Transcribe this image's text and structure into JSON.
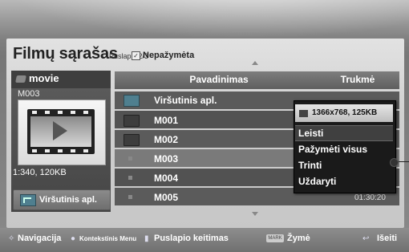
{
  "header": {
    "title": "Filmų sąrašas",
    "page_indicator": "Puslapis 2/3",
    "checkbox_symbol": "✓",
    "unselected_label": "Nepažymėta"
  },
  "left_panel": {
    "type_label": "movie",
    "selected_file": "M003",
    "file_info": "1:340, 120KB",
    "up_folder_button": "Viršutinis apl."
  },
  "list": {
    "columns": [
      "Pavadinimas",
      "Trukmė"
    ],
    "rows": [
      {
        "name": "Viršutinis apl.",
        "duration": "",
        "icon": "folder-up-icon"
      },
      {
        "name": "M001",
        "duration": "",
        "icon": "folder-icon"
      },
      {
        "name": "M002",
        "duration": "",
        "icon": "folder-icon"
      },
      {
        "name": "M003",
        "duration": "",
        "icon": "file-icon",
        "highlighted": true
      },
      {
        "name": "M004",
        "duration": "",
        "icon": "file-icon"
      },
      {
        "name": "M005",
        "duration": "01:30:20",
        "icon": "file-icon"
      }
    ]
  },
  "context_menu": {
    "info": "1366x768, 125KB",
    "items": [
      "Leisti",
      "Pažymėti visus",
      "Trinti",
      "Uždaryti"
    ],
    "selected_index": 0
  },
  "footer": {
    "navigation": "Navigacija",
    "context_menu": "Kontekstinis Menu",
    "page_change": "Puslapio keitimas",
    "mark_key": "MARK",
    "mark": "Žymė",
    "exit": "Išeiti"
  },
  "colors": {
    "panel_bg": "#d0d0d0",
    "row_bg": "#5b5b5b",
    "highlight_row": "#7a7a7a",
    "menu_bg": "#1a1a1a"
  }
}
